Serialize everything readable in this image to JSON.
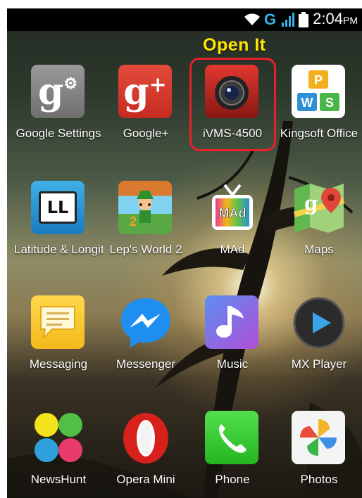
{
  "status_bar": {
    "carrier": "G",
    "time": "2:04",
    "ampm": "PM"
  },
  "annotation": {
    "text": "Open It"
  },
  "apps": [
    {
      "label": "Google Settings",
      "icon": "google-settings-icon"
    },
    {
      "label": "Google+",
      "icon": "google-plus-icon"
    },
    {
      "label": "iVMS-4500",
      "icon": "ivms-camera-icon"
    },
    {
      "label": "Kingsoft Office",
      "icon": "kingsoft-office-icon",
      "tiles": [
        "P",
        "W",
        "S"
      ]
    },
    {
      "label": "Latitude & Longitu",
      "icon": "latitude-icon",
      "glyph": "LL"
    },
    {
      "label": "Lep's World 2",
      "icon": "leps-world-icon"
    },
    {
      "label": "MAd",
      "icon": "mad-tv-icon",
      "glyph": "MAd"
    },
    {
      "label": "Maps",
      "icon": "maps-icon"
    },
    {
      "label": "Messaging",
      "icon": "messaging-icon"
    },
    {
      "label": "Messenger",
      "icon": "messenger-icon"
    },
    {
      "label": "Music",
      "icon": "music-icon"
    },
    {
      "label": "MX Player",
      "icon": "mx-player-icon"
    },
    {
      "label": "NewsHunt",
      "icon": "newshunt-icon"
    },
    {
      "label": "Opera Mini",
      "icon": "opera-mini-icon"
    },
    {
      "label": "Phone",
      "icon": "phone-icon"
    },
    {
      "label": "Photos",
      "icon": "photos-icon"
    }
  ],
  "colors": {
    "annotation": "#ffe600",
    "highlight": "#e8202a",
    "status_accent": "#33b5e5"
  }
}
